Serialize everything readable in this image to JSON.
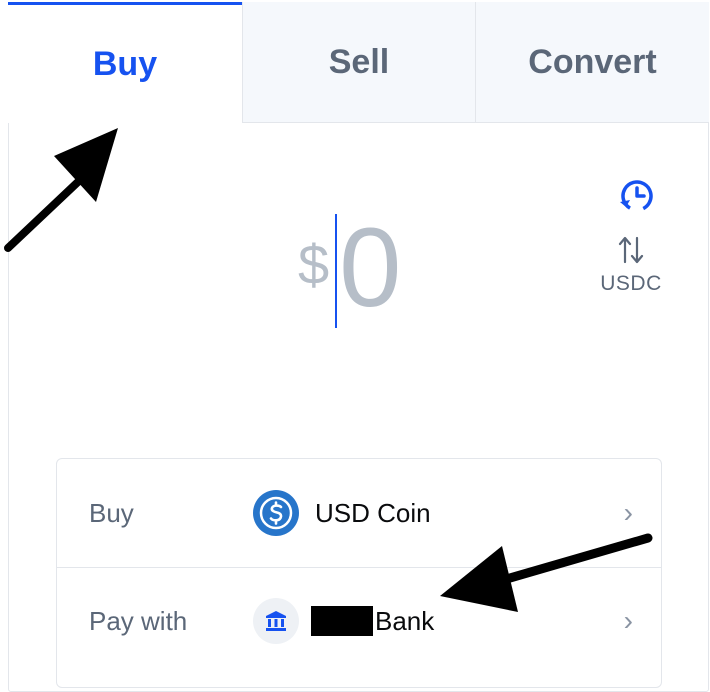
{
  "tabs": [
    {
      "label": "Buy",
      "active": true
    },
    {
      "label": "Sell",
      "active": false
    },
    {
      "label": "Convert",
      "active": false
    }
  ],
  "amount": {
    "currency_symbol": "$",
    "value": "0"
  },
  "toggle": {
    "currency_label": "USDC",
    "icon": "swap-arrows-icon"
  },
  "history": {
    "icon": "history-clock-icon"
  },
  "rows": {
    "buy": {
      "label": "Buy",
      "value": "USD Coin",
      "icon": "usd-coin-icon"
    },
    "pay": {
      "label": "Pay with",
      "value": "Bank",
      "icon": "bank-icon"
    }
  },
  "colors": {
    "accent": "#1652f0",
    "muted_text": "#5b6778",
    "placeholder": "#b6bec8",
    "tab_inactive_bg": "#f5f8fc"
  }
}
